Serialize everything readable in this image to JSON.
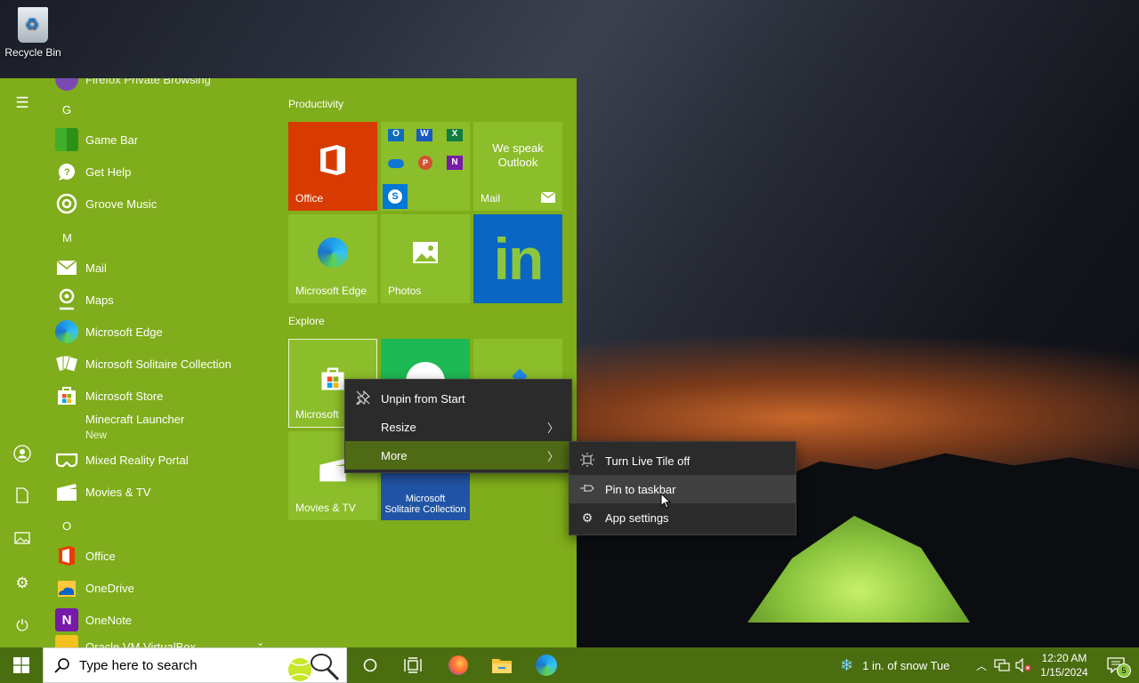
{
  "desktop": {
    "recycle_bin_label": "Recycle Bin"
  },
  "start_menu": {
    "accent": "#7fad1b",
    "partial_top_item": "Firefox Private Browsing",
    "letters": {
      "g": "G",
      "m": "M",
      "o": "O"
    },
    "apps": {
      "game_bar": "Game Bar",
      "get_help": "Get Help",
      "groove_music": "Groove Music",
      "mail": "Mail",
      "maps": "Maps",
      "microsoft_edge": "Microsoft Edge",
      "solitaire": "Microsoft Solitaire Collection",
      "store": "Microsoft Store",
      "minecraft": "Minecraft Launcher",
      "minecraft_sub": "New",
      "mixed_reality": "Mixed Reality Portal",
      "movies": "Movies & TV",
      "office": "Office",
      "onedrive": "OneDrive",
      "onenote": "OneNote",
      "virtualbox": "Oracle VM VirtualBox"
    },
    "groups": {
      "productivity": "Productivity",
      "explore": "Explore"
    },
    "tiles": {
      "office": "Office",
      "mail_line1": "We speak",
      "mail_line2": "Outlook",
      "mail": "Mail",
      "edge": "Microsoft Edge",
      "photos": "Photos",
      "linkedin": "in",
      "store": "Microsoft",
      "movies": "Movies & TV",
      "solitaire_line1": "Microsoft",
      "solitaire_line2": "Solitaire Collection"
    }
  },
  "context_menu": {
    "unpin": "Unpin from Start",
    "resize": "Resize",
    "more": "More"
  },
  "submenu": {
    "live_tile": "Turn Live Tile off",
    "pin_taskbar": "Pin to taskbar",
    "app_settings": "App settings"
  },
  "taskbar": {
    "search_placeholder": "Type here to search",
    "weather": "1 in. of snow Tue",
    "time": "12:20 AM",
    "date": "1/15/2024",
    "notification_count": "5"
  }
}
